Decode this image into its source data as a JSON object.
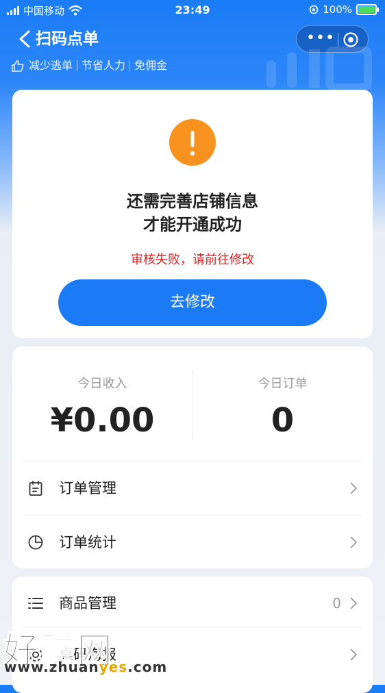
{
  "status_bar": {
    "carrier": "中国移动",
    "time": "23:49",
    "battery": "100%"
  },
  "header": {
    "title": "扫码点单",
    "taglines": [
      "减少逃单",
      "节省人力",
      "免佣金"
    ]
  },
  "alert_card": {
    "message_line1": "还需完善店铺信息",
    "message_line2": "才能开通成功",
    "error_text": "审核失败，请前往修改",
    "button_label": "去修改"
  },
  "stats": {
    "income_label": "今日收入",
    "income_value": "¥0.00",
    "orders_label": "今日订单",
    "orders_value": "0"
  },
  "menu_group1": [
    {
      "label": "订单管理",
      "icon": "clipboard-icon"
    },
    {
      "label": "订单统计",
      "icon": "pie-chart-icon"
    }
  ],
  "menu_group2": [
    {
      "label": "商品管理",
      "icon": "list-icon",
      "count": "0"
    },
    {
      "label": "桌码海报",
      "icon": "settings-icon"
    }
  ],
  "watermark": {
    "text": "好赚网",
    "site_prefix": "www.zhuan",
    "site_highlight": "yes",
    "site_suffix": ".com"
  },
  "colors": {
    "primary": "#1b7af5",
    "warning": "#f8921e",
    "error": "#e02020"
  }
}
